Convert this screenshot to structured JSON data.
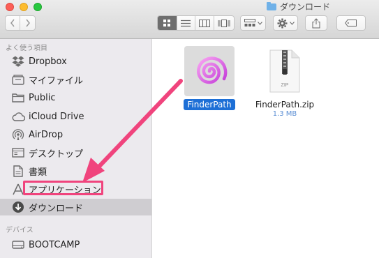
{
  "window": {
    "title": "ダウンロード"
  },
  "toolbar": {
    "back_icon": "chevron-left-icon",
    "forward_icon": "chevron-right-icon",
    "view_modes": [
      "icon-view-icon",
      "list-view-icon",
      "column-view-icon",
      "cover-flow-icon"
    ],
    "active_view": "icon-view-icon",
    "arrange_icon": "arrange-icon",
    "action_icon": "gear-icon",
    "share_icon": "share-icon",
    "tag_icon": "tag-icon"
  },
  "sidebar": {
    "favorites_heading": "よく使う項目",
    "favorites": [
      {
        "label": "Dropbox",
        "icon": "dropbox-icon"
      },
      {
        "label": "マイファイル",
        "icon": "all-my-files-icon"
      },
      {
        "label": "Public",
        "icon": "folder-icon"
      },
      {
        "label": "iCloud Drive",
        "icon": "cloud-icon"
      },
      {
        "label": "AirDrop",
        "icon": "airdrop-icon"
      },
      {
        "label": "デスクトップ",
        "icon": "desktop-icon"
      },
      {
        "label": "書類",
        "icon": "document-icon"
      },
      {
        "label": "アプリケーション",
        "icon": "applications-icon"
      },
      {
        "label": "ダウンロード",
        "icon": "download-icon",
        "selected": true
      }
    ],
    "devices_heading": "デバイス",
    "devices": [
      {
        "label": "BOOTCAMP",
        "icon": "disk-icon"
      }
    ]
  },
  "files": [
    {
      "name": "FinderPath",
      "selected": true,
      "icon": "finderpath-app-icon"
    },
    {
      "name": "FinderPath.zip",
      "size": "1.3 MB",
      "icon": "zip-file-icon",
      "badge": "ZIP"
    }
  ],
  "colors": {
    "annotation": "#f0447d",
    "selection": "#1d6fd6"
  }
}
